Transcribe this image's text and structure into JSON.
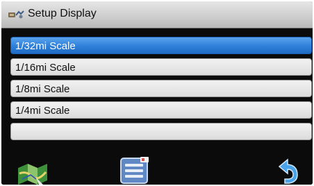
{
  "titlebar": {
    "title": "Setup Display",
    "icon": "setup-display-icon"
  },
  "scale_options": [
    {
      "label": "1/32mi Scale",
      "selected": true
    },
    {
      "label": "1/16mi Scale",
      "selected": false
    },
    {
      "label": "1/8mi Scale",
      "selected": false
    },
    {
      "label": "1/4mi Scale",
      "selected": false
    },
    {
      "label": "",
      "selected": false
    }
  ],
  "bottombar": {
    "map_icon": "map-icon",
    "menu_icon": "menu-list-icon",
    "back_icon": "back-arrow-icon"
  },
  "colors": {
    "selected_row": "#2e7fd8",
    "row_background": "#dcdcdc",
    "frame": "#0b0b0b"
  }
}
